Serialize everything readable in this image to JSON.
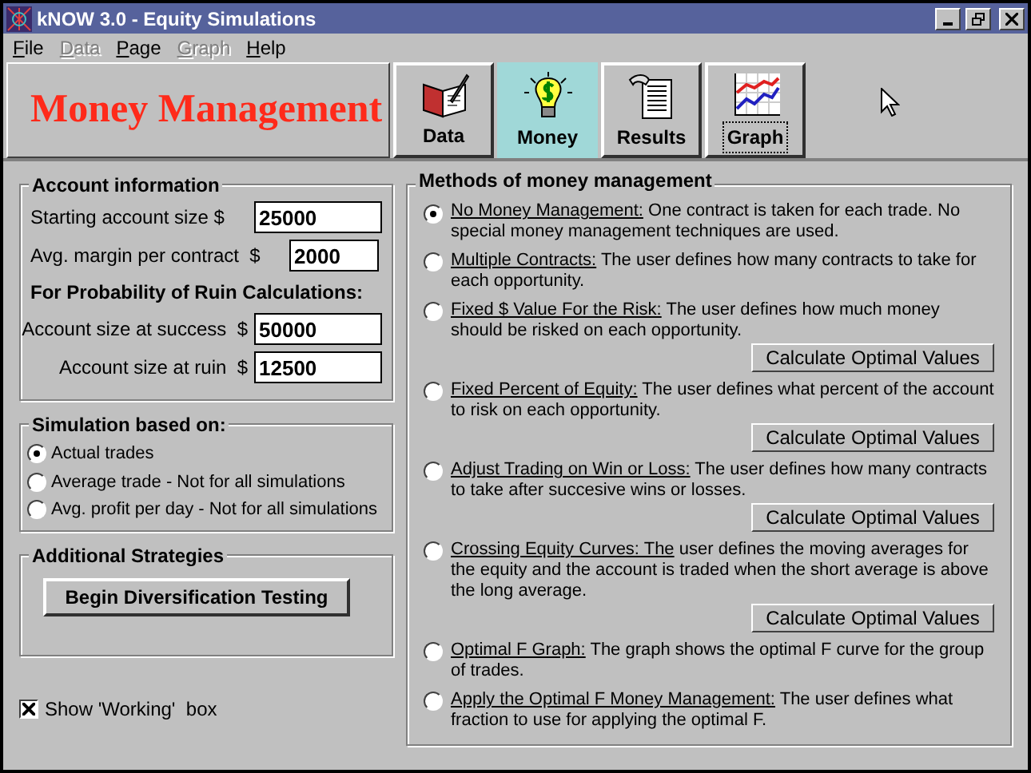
{
  "window": {
    "title": "kNOW 3.0 - Equity Simulations"
  },
  "menu": [
    {
      "label": "File",
      "disabled": false
    },
    {
      "label": "Data",
      "disabled": true
    },
    {
      "label": "Page",
      "disabled": false
    },
    {
      "label": "Graph",
      "disabled": true
    },
    {
      "label": "Help",
      "disabled": false
    }
  ],
  "page_title": "Money Management",
  "tabs": [
    {
      "kind": "data",
      "label": "Data",
      "selected": false,
      "focused": false
    },
    {
      "kind": "money",
      "label": "Money",
      "selected": true,
      "focused": false
    },
    {
      "kind": "results",
      "label": "Results",
      "selected": false,
      "focused": false
    },
    {
      "kind": "graph",
      "label": "Graph",
      "selected": false,
      "focused": true
    }
  ],
  "account": {
    "title": "Account information",
    "fields": [
      {
        "label": "Starting account size $",
        "value": "25000",
        "kind": "wide"
      },
      {
        "label": "Avg. margin per contract  $",
        "value": "2000",
        "kind": "narrow"
      }
    ],
    "subtitle": "For Probability of Ruin Calculations:",
    "ruin_fields": [
      {
        "label": "Account size at success  $",
        "value": "50000"
      },
      {
        "label": "Account size at ruin  $",
        "value": "12500"
      }
    ]
  },
  "simulation": {
    "title": "Simulation based on:",
    "options": [
      {
        "label": "Actual trades",
        "selected": true
      },
      {
        "label": "Average trade - Not for all simulations",
        "selected": false
      },
      {
        "label": "Avg. profit per day - Not for all simulations",
        "selected": false
      }
    ]
  },
  "strategies": {
    "title": "Additional Strategies",
    "button": "Begin Diversification Testing"
  },
  "show_working": {
    "label": "Show 'Working'  box",
    "checked": true
  },
  "methods": {
    "title": "Methods of money management",
    "items": [
      {
        "name": "No Money Management:",
        "text": "One contract is taken for each trade. No special money management techniques are used.",
        "selected": true
      },
      {
        "name": "Multiple Contracts:",
        "text": "The user defines how many contracts to take for each opportunity.",
        "selected": false
      },
      {
        "name": "Fixed $ Value For the Risk:",
        "text": "The user defines how much money should be risked on each opportunity.",
        "selected": false,
        "button": "Calculate Optimal Values"
      },
      {
        "name": "Fixed Percent of Equity:",
        "text": "The user defines what percent of the account to risk on each opportunity.",
        "selected": false,
        "button": "Calculate Optimal Values"
      },
      {
        "name": "Adjust Trading on Win or Loss:",
        "text": "The user defines how many contracts to take after succesive wins or losses.",
        "selected": false,
        "button": "Calculate Optimal Values"
      },
      {
        "name": "Crossing Equity Curves: The",
        "text": "user defines the moving averages for the equity and the account is traded when the short average is above the long average.",
        "selected": false,
        "button": "Calculate Optimal Values"
      },
      {
        "name": "Optimal F Graph:",
        "text": "The graph shows the optimal F curve for the group of trades.",
        "selected": false
      },
      {
        "name": "Apply the Optimal F Money Management:",
        "text": "The user defines what fraction to use for applying the optimal F.",
        "selected": false
      }
    ]
  }
}
